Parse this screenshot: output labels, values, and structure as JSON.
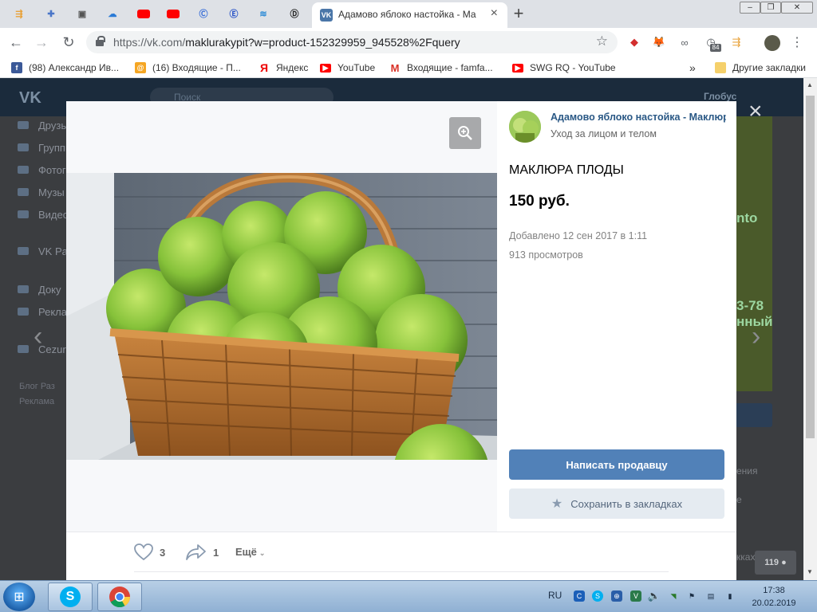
{
  "browser": {
    "active_tab_title": "Адамово яблоко настойка - Ма",
    "close_tab": "×",
    "new_tab": "+",
    "url_host": "https://vk.com/",
    "url_path": "maklurakypit?w=product-152329959_945528%2Fquery",
    "extension_badge": "84"
  },
  "bookmarks": [
    {
      "label": "(98) Александр Ив...",
      "icon": "facebook-icon",
      "color": "#3b5998",
      "glyph": "f"
    },
    {
      "label": "(16) Входящие - П...",
      "icon": "mail-icon",
      "color": "#f5a623",
      "glyph": "@"
    },
    {
      "label": "Яндекс",
      "icon": "yandex-icon",
      "color": "#ffffff",
      "glyph": "Я"
    },
    {
      "label": "YouTube",
      "icon": "youtube-icon",
      "color": "#ff0000",
      "glyph": "▶"
    },
    {
      "label": "Входящие - famfa...",
      "icon": "gmail-icon",
      "color": "#ffffff",
      "glyph": "M"
    },
    {
      "label": "SWG RQ - YouTube",
      "icon": "youtube-icon",
      "color": "#ff0000",
      "glyph": "▶"
    }
  ],
  "bookmarks_more": "»",
  "other_bookmarks": "Другие закладки",
  "vk": {
    "logo": "VK",
    "search_placeholder": "Поиск",
    "user_name": "Глобус",
    "sidebar": [
      "Друзья",
      "Группы",
      "Фотог",
      "Музы",
      "Видео",
      "VK Pa",
      "Доку",
      "Рекла",
      "Cezur"
    ],
    "footer_1": "Блог   Раз",
    "footer_2": "Реклама",
    "right_texts": [
      "nto",
      "3-78",
      "нный"
    ],
    "right_links": [
      "ения",
      "е"
    ],
    "right_bottom": "кках",
    "view_count": "119",
    "close": "×",
    "prev": "‹",
    "next": "›"
  },
  "product": {
    "shop_name": "Адамово яблоко настойка - Маклюра",
    "shop_category": "Уход за лицом и телом",
    "title": "МАКЛЮРА ПЛОДЫ",
    "price": "150 руб.",
    "added": "Добавлено 12 сен 2017 в 1:11",
    "views": "913 просмотров",
    "message_button": "Написать продавцу",
    "bookmark_button": "Сохранить в закладках",
    "likes": "3",
    "shares": "1",
    "more": "Ещё"
  },
  "taskbar": {
    "lang": "RU",
    "time": "17:38",
    "date": "20.02.2019"
  }
}
